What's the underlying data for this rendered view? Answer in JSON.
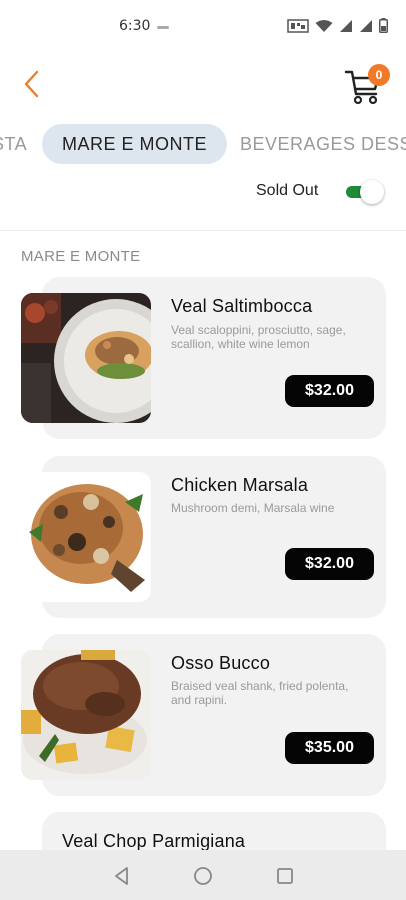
{
  "status": {
    "time": "6:30"
  },
  "header": {
    "cart_count": "0"
  },
  "tabs": [
    {
      "label": "STA"
    },
    {
      "label": "MARE E MONTE"
    },
    {
      "label": "BEVERAGES"
    },
    {
      "label": "DESS"
    }
  ],
  "filter": {
    "sold_out_label": "Sold Out"
  },
  "section": {
    "title": "MARE E MONTE"
  },
  "items": [
    {
      "name": "Veal Saltimbocca",
      "description": "Veal scaloppini, prosciutto, sage, scallion, white wine lemon",
      "price": "$32.00"
    },
    {
      "name": "Chicken Marsala",
      "description": "Mushroom demi, Marsala wine",
      "price": "$32.00"
    },
    {
      "name": "Osso Bucco",
      "description": "Braised veal shank, fried polenta, and rapini.",
      "price": "$35.00"
    },
    {
      "name": "Veal Chop Parmigiana"
    }
  ],
  "colors": {
    "accent": "#ee7a2a",
    "toggle_on": "#1e8b3a",
    "active_tab_bg": "#dde6ee",
    "price_bg": "#050505"
  }
}
